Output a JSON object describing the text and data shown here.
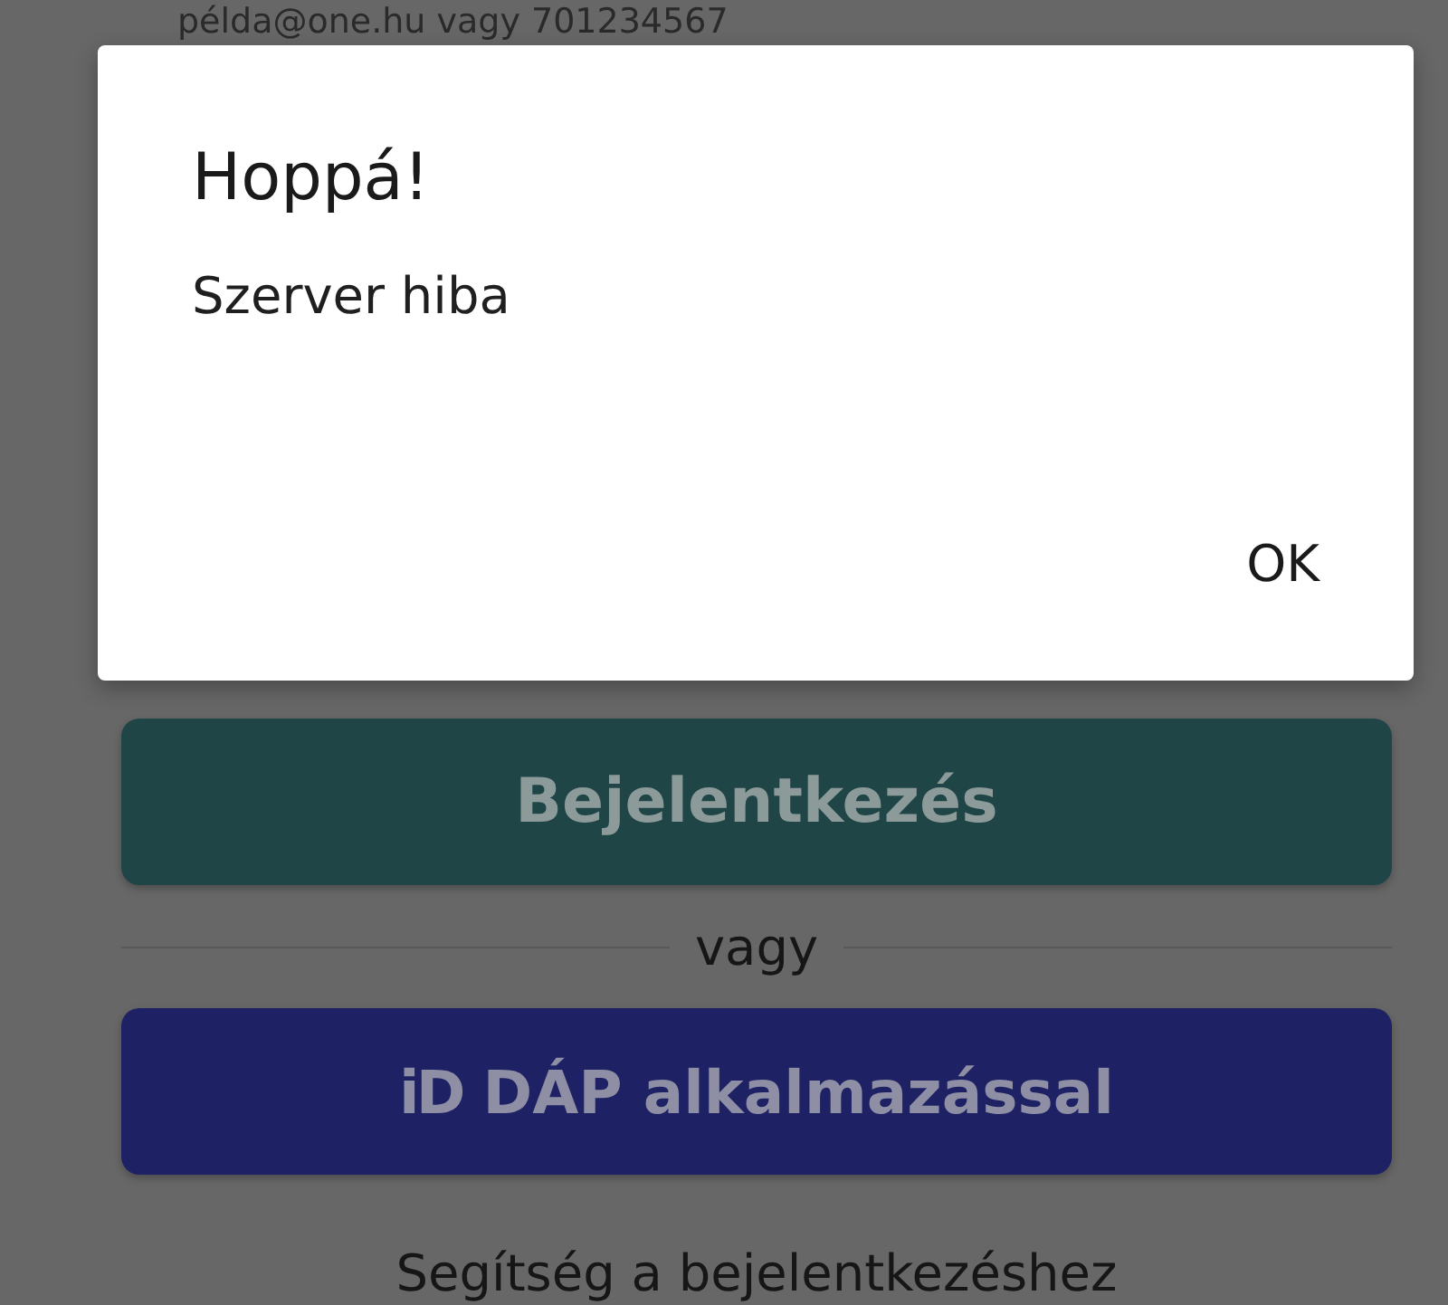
{
  "background": {
    "login_hint": "példa@one.hu vagy 701234567",
    "login_button": "Bejelentkezés",
    "divider": "vagy",
    "dap_button": {
      "logo": "iD",
      "label": "DÁP alkalmazással"
    },
    "help_link": "Segítség a bejelentkezéshez"
  },
  "dialog": {
    "title": "Hoppá!",
    "message": "Szerver hiba",
    "buttons": [
      "OK"
    ]
  }
}
